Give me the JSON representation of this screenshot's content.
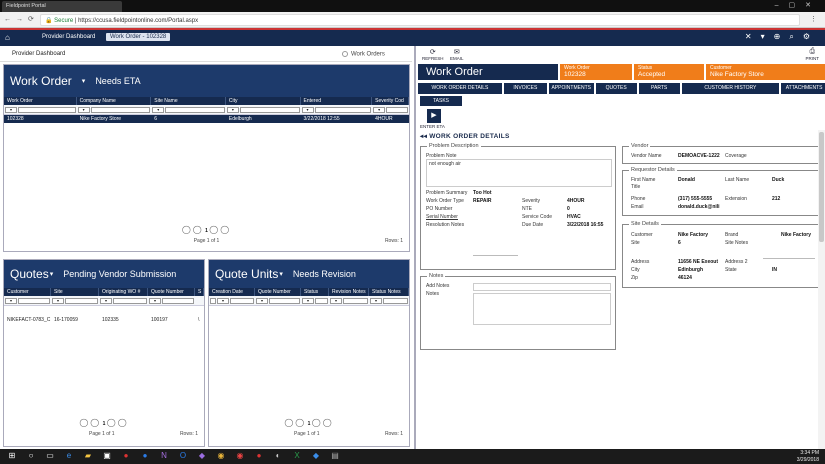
{
  "browser": {
    "tab_title": "Fieldpoint Portal",
    "url_secure": "Secure",
    "url": "https://ccusa.fieldpointonline.com/Portal.aspx"
  },
  "header": {
    "crumbs": [
      "Provider Dashboard",
      "Work Order - 102328"
    ]
  },
  "leftbar": {
    "title": "Provider Dashboard",
    "toggle_label": "Work Orders"
  },
  "work_orders": {
    "title": "Work Order",
    "subtitle": "Needs ETA",
    "columns": [
      "Work Order",
      "Company Name",
      "Site Name",
      "City",
      "Entered",
      "Severity Cod"
    ],
    "rows": [
      [
        "102328",
        "Nike Factory Store",
        "6",
        "Edelburgh",
        "3/22/2018 12:55",
        "4HOUR"
      ]
    ],
    "pager": {
      "page": "1",
      "info": "Page 1 of 1",
      "rows": "Rows: 1"
    }
  },
  "quotes": {
    "title": "Quotes",
    "subtitle": "Pending Vendor Submission",
    "columns": [
      "Customer",
      "Site",
      "Originating WO #",
      "Quote Number",
      "S"
    ],
    "rows": [
      [
        "NIKEFACT-0783_C",
        "16-170059",
        "102335",
        "100197",
        "\\"
      ]
    ],
    "pager": {
      "page": "1",
      "info": "Page 1 of 1",
      "rows": "Rows: 1"
    }
  },
  "quote_units": {
    "title": "Quote Units",
    "subtitle": "Needs Revision",
    "columns": [
      "Creation Date",
      "Quote Number",
      "Status",
      "Revision Notes",
      "Status Notes"
    ],
    "pager": {
      "page": "1",
      "info": "Page 1 of 1",
      "rows": "Rows: 1"
    }
  },
  "toolbar": {
    "refresh": "REFRESH",
    "email": "EMAIL",
    "print": "PRINT"
  },
  "work_order": {
    "title": "Work Order",
    "wo_label": "Work Order",
    "wo_value": "102328",
    "status_label": "Status",
    "status_value": "Accepted",
    "customer_label": "Customer",
    "customer_value": "Nike Factory Store",
    "tabs": [
      "WORK ORDER DETAILS",
      "INVOICES",
      "APPOINTMENTS",
      "QUOTES",
      "PARTS",
      "CUSTOMER HISTORY",
      "ATTACHMENTS"
    ],
    "tasks_tab": "TASKS",
    "enter_eta": "ENTER ETA",
    "section_title": "WORK ORDER DETAILS"
  },
  "problem": {
    "legend": "Problem Description",
    "note_label": "Problem Note",
    "note_value": "not enough air",
    "summary_label": "Problem Summary",
    "summary_value": "Too Hot",
    "type_label": "Work Order Type",
    "type_value": "REPAIR",
    "severity_label": "Severity",
    "severity_value": "4HOUR",
    "po_label": "PO Number",
    "nte_label": "NTE",
    "nte_value": "0",
    "serial_label": "Serial Number",
    "service_label": "Service Code",
    "service_value": "HVAC",
    "resolution_label": "Resolution Notes",
    "due_label": "Due Date",
    "due_value": "3/22/2018 16:55"
  },
  "notes": {
    "legend": "Notes",
    "add_label": "Add Notes",
    "notes_label": "Notes"
  },
  "vendor": {
    "legend": "Vendor",
    "name_label": "Vendor Name",
    "name_value": "DEMOACVE-1222",
    "coverage_label": "Coverage"
  },
  "requestor": {
    "legend": "Requestor Details",
    "first_label": "First Name",
    "first_value": "Donald",
    "last_label": "Last Name",
    "last_value": "Duck",
    "title_label": "Title",
    "phone_label": "Phone",
    "phone_value": "(317) 555-5555",
    "ext_label": "Extension",
    "ext_value": "212",
    "email_label": "Email",
    "email_value": "donald.duck@nili"
  },
  "site": {
    "legend": "Site Details",
    "customer_label": "Customer",
    "customer_value": "Nike Factory",
    "brand_label": "Brand",
    "brand_value": "Nike Factory",
    "site_label": "Site",
    "site_value": "6",
    "site_notes_label": "Site Notes",
    "address_label": "Address",
    "address_value": "11656 NE Exeout",
    "address2_label": "Address 2",
    "city_label": "City",
    "city_value": "Edinburgh",
    "state_label": "State",
    "state_value": "IN",
    "zip_label": "Zip",
    "zip_value": "46124"
  },
  "taskbar": {
    "time": "3:34 PM",
    "date": "3/29/2018"
  },
  "colors": {
    "navy": "#152a4f",
    "orange": "#f07d1a",
    "red_accent": "#cc3333"
  }
}
